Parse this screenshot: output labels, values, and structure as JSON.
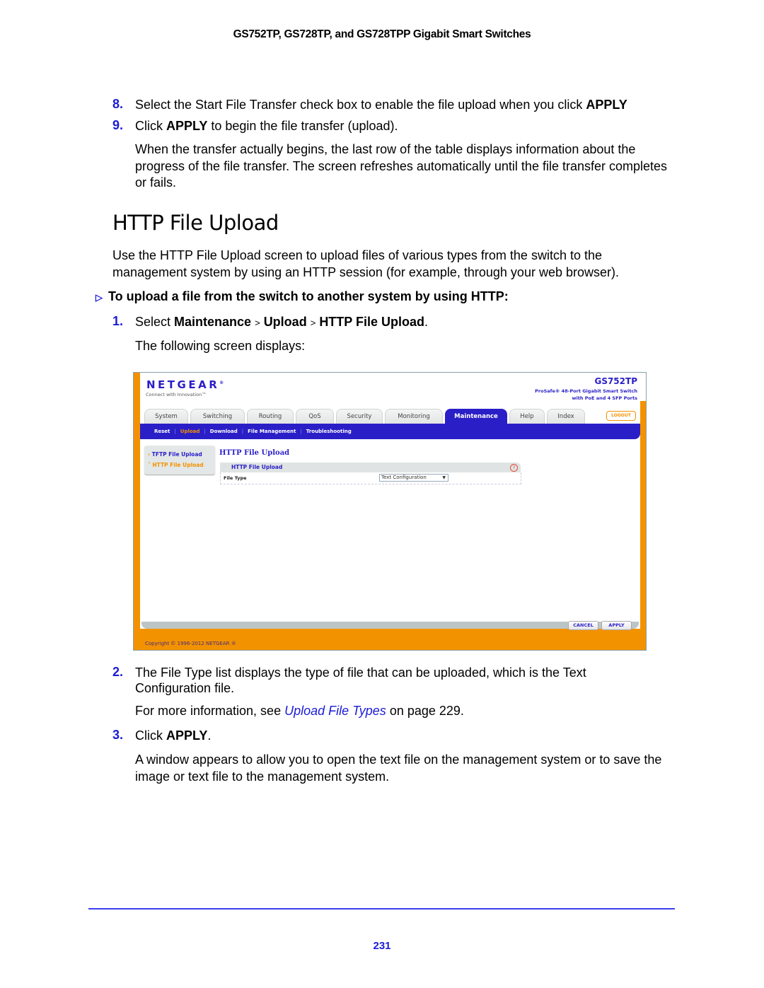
{
  "header": {
    "running_title": "GS752TP, GS728TP, and GS728TPP Gigabit Smart Switches"
  },
  "steps_top": [
    {
      "num": "8.",
      "text_pre": "Select the Start File Transfer check box to enable the file upload when you click ",
      "bold": "APPLY",
      "text_post": ""
    },
    {
      "num": "9.",
      "text_pre": "Click ",
      "bold": "APPLY",
      "text_post": " to begin the file transfer (upload)."
    }
  ],
  "note_top": "When the transfer actually begins, the last row of the table displays information about the progress of the file transfer. The screen refreshes automatically until the file transfer completes or fails.",
  "section": {
    "title": "HTTP File Upload",
    "intro": "Use the HTTP File Upload screen to upload files of various types from the switch to the management system by using an HTTP session (for example, through your web browser).",
    "procedure_icon": "arrow-bullet-icon",
    "procedure_heading": "To upload a file from the switch to another system by using HTTP:",
    "step1": {
      "num": "1.",
      "pre": "Select ",
      "path": [
        "Maintenance",
        "Upload",
        "HTTP File Upload"
      ],
      "sep": ">",
      "post": "."
    },
    "step1_note": "The following screen displays:",
    "step2": {
      "num": "2.",
      "text": "The File Type list displays the type of file that can be uploaded, which is the Text Configuration file."
    },
    "step2_note": {
      "pre": "For more information, see ",
      "link": "Upload File Types",
      "post": " on page 229."
    },
    "step3": {
      "num": "3.",
      "pre": "Click ",
      "bold": "APPLY",
      "post": "."
    },
    "step3_note": "A window appears to allow you to open the text file on the management system or to save the image or text file to the management system."
  },
  "screenshot": {
    "brand": "NETGEAR",
    "brand_mark": "®",
    "tagline": "Connect with Innovation™",
    "model": "GS752TP",
    "model_desc_1": "ProSafe® 48-Port Gigabit Smart Switch",
    "model_desc_2": "with PoE and 4 SFP Ports",
    "tabs": [
      {
        "label": "System",
        "active": false
      },
      {
        "label": "Switching",
        "active": false
      },
      {
        "label": "Routing",
        "active": false
      },
      {
        "label": "QoS",
        "active": false
      },
      {
        "label": "Security",
        "active": false
      },
      {
        "label": "Monitoring",
        "active": false
      },
      {
        "label": "Maintenance",
        "active": true
      },
      {
        "label": "Help",
        "active": false
      },
      {
        "label": "Index",
        "active": false
      }
    ],
    "logout_label": "LOGOUT",
    "subnav": [
      {
        "label": "Reset",
        "active": false
      },
      {
        "label": "Upload",
        "active": true
      },
      {
        "label": "Download",
        "active": false
      },
      {
        "label": "File Management",
        "active": false
      },
      {
        "label": "Troubleshooting",
        "active": false
      }
    ],
    "leftnav": [
      {
        "label": "TFTP File Upload",
        "marker": "›",
        "active": false
      },
      {
        "label": "HTTP File Upload",
        "marker": "˅",
        "active": true
      }
    ],
    "content_title": "HTTP File Upload",
    "panel_title": "HTTP File Upload",
    "panel_handle": "::",
    "help_glyph": "?",
    "file_type_label": "File Type",
    "file_type_value": "Text Configuration",
    "cancel_label": "CANCEL",
    "apply_label": "APPLY",
    "copyright": "Copyright © 1996-2012 NETGEAR ®",
    "colors": {
      "brand_blue": "#2a1fc7",
      "brand_orange": "#f39200"
    }
  },
  "footer": {
    "page_number": "231"
  }
}
